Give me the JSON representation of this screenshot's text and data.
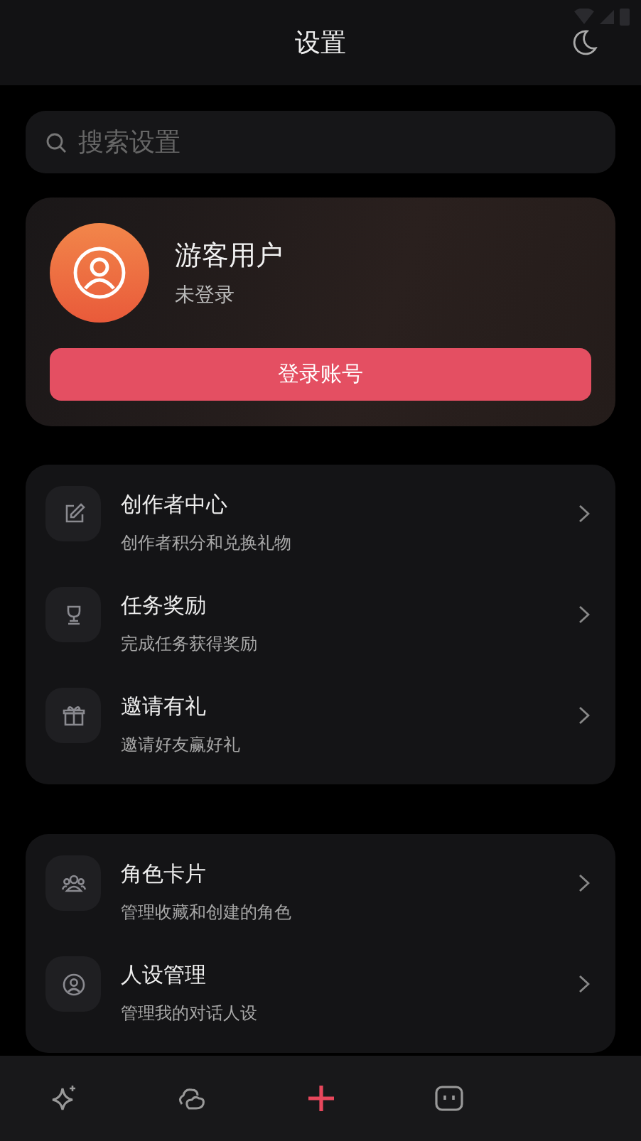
{
  "header": {
    "title": "设置"
  },
  "search": {
    "placeholder": "搜索设置"
  },
  "profile": {
    "name": "游客用户",
    "status": "未登录",
    "login_button": "登录账号"
  },
  "groups": [
    {
      "items": [
        {
          "kind": "edit",
          "title": "创作者中心",
          "subtitle": "创作者积分和兑换礼物"
        },
        {
          "kind": "trophy",
          "title": "任务奖励",
          "subtitle": "完成任务获得奖励"
        },
        {
          "kind": "gift",
          "title": "邀请有礼",
          "subtitle": "邀请好友赢好礼"
        }
      ]
    },
    {
      "items": [
        {
          "kind": "people",
          "title": "角色卡片",
          "subtitle": "管理收藏和创建的角色"
        },
        {
          "kind": "person",
          "title": "人设管理",
          "subtitle": "管理我的对话人设"
        }
      ]
    }
  ],
  "nav": [
    {
      "kind": "sparkle"
    },
    {
      "kind": "clouds"
    },
    {
      "kind": "plus"
    },
    {
      "kind": "robot"
    }
  ]
}
